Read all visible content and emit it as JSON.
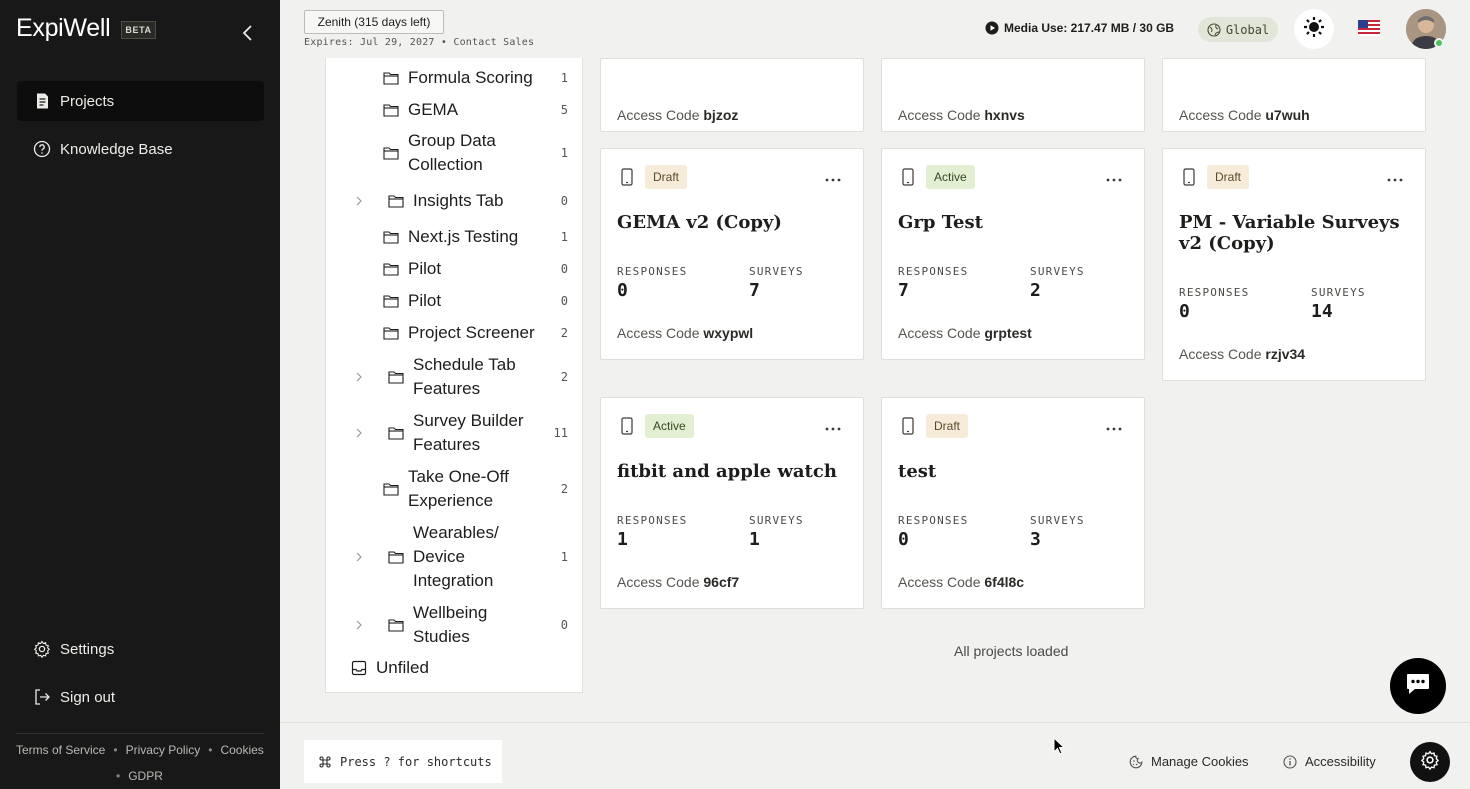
{
  "app": {
    "logo": "ExpiWell",
    "beta": "BETA"
  },
  "sidebar": {
    "items": [
      {
        "label": "Projects",
        "icon": "document-icon",
        "active": true
      },
      {
        "label": "Knowledge Base",
        "icon": "help-circle-icon",
        "active": false
      }
    ],
    "settings_label": "Settings",
    "signout_label": "Sign out",
    "links": {
      "terms": "Terms of Service",
      "privacy": "Privacy Policy",
      "cookies": "Cookies",
      "gdpr": "GDPR"
    }
  },
  "topbar": {
    "plan": "Zenith (315 days left)",
    "expires": "Expires: Jul 29, 2027",
    "contact": "Contact Sales",
    "separator": "•",
    "media_use_label": "Media Use: 217.47 MB",
    "media_use_total": "/ 30 GB",
    "region": "Global",
    "colors": {
      "region_bg": "#e2e6d8",
      "online": "#4cc35a"
    }
  },
  "folders": [
    {
      "name": "Formula Scoring",
      "count": "1",
      "expandable": false
    },
    {
      "name": "GEMA",
      "count": "5",
      "expandable": false
    },
    {
      "name": "Group Data Collection",
      "count": "1",
      "expandable": false
    },
    {
      "name": "Insights Tab",
      "count": "0",
      "expandable": true
    },
    {
      "name": "Next.js Testing",
      "count": "1",
      "expandable": false
    },
    {
      "name": "Pilot",
      "count": "0",
      "expandable": false
    },
    {
      "name": "Pilot",
      "count": "0",
      "expandable": false
    },
    {
      "name": "Project Screener",
      "count": "2",
      "expandable": false
    },
    {
      "name": "Schedule Tab Features",
      "count": "2",
      "expandable": true
    },
    {
      "name": "Survey Builder Features",
      "count": "11",
      "expandable": true
    },
    {
      "name": "Take One-Off Experience",
      "count": "2",
      "expandable": false
    },
    {
      "name": "Wearables/ Device Integration",
      "count": "1",
      "expandable": true
    },
    {
      "name": "Wellbeing Studies",
      "count": "0",
      "expandable": true
    }
  ],
  "unfiled_label": "Unfiled",
  "labels": {
    "responses": "RESPONSES",
    "surveys": "SURVEYS",
    "access_code": "Access Code"
  },
  "cards_partial": [
    {
      "code": "bjzoz"
    },
    {
      "code": "hxnvs"
    },
    {
      "code": "u7wuh"
    }
  ],
  "cards": [
    {
      "status": "Draft",
      "title": "GEMA v2 (Copy)",
      "responses": "0",
      "surveys": "7",
      "code": "wxypwl"
    },
    {
      "status": "Active",
      "title": "Grp Test",
      "responses": "7",
      "surveys": "2",
      "code": "grptest"
    },
    {
      "status": "Draft",
      "title": "PM - Variable Surveys v2 (Copy)",
      "responses": "0",
      "surveys": "14",
      "code": "rzjv34"
    },
    {
      "status": "Active",
      "title": "fitbit and apple watch",
      "responses": "1",
      "surveys": "1",
      "code": "96cf7"
    },
    {
      "status": "Draft",
      "title": "test",
      "responses": "0",
      "surveys": "3",
      "code": "6f4l8c"
    }
  ],
  "status_text": "All projects loaded",
  "footer": {
    "shortcut": "Press ? for shortcuts",
    "manage_cookies": "Manage Cookies",
    "accessibility": "Accessibility"
  }
}
